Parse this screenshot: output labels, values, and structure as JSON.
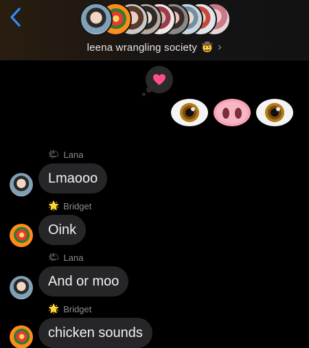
{
  "header": {
    "group_name": "leena wrangling society",
    "title_emoji": "🤠",
    "chevron": "›",
    "back_icon": "chevron-left-icon",
    "avatar_count": 9
  },
  "reaction": {
    "emoji": "❤",
    "color": "#ff4f8b"
  },
  "emoji_message": {
    "emojis": [
      "eye",
      "pig-nose",
      "eye"
    ]
  },
  "messages": [
    {
      "sender": "Lana",
      "sender_emoji": "🌤",
      "text": "Lmaooo"
    },
    {
      "sender": "Bridget",
      "sender_emoji": "🌟",
      "text": "Oink"
    },
    {
      "sender": "Lana",
      "sender_emoji": "🌤",
      "text": "And or moo"
    },
    {
      "sender": "Bridget",
      "sender_emoji": "🌟",
      "text": "chicken sounds"
    }
  ],
  "colors": {
    "accent": "#2f8cff",
    "bubble": "#262628",
    "background": "#000000"
  }
}
